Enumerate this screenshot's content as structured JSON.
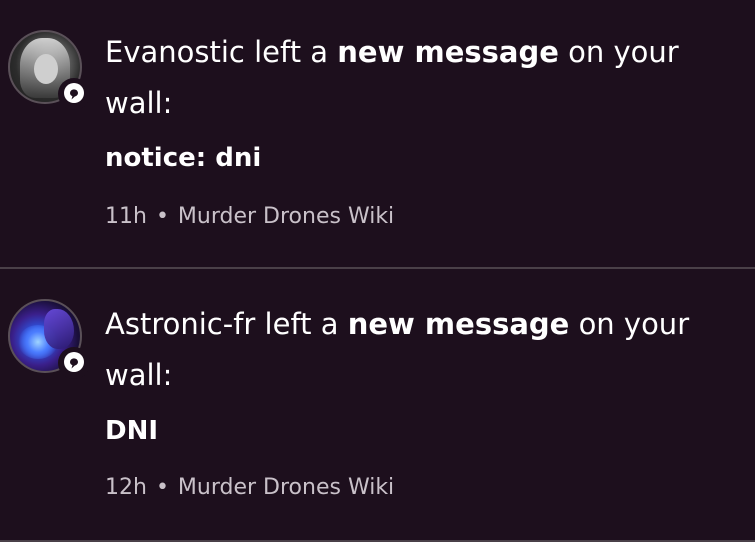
{
  "notifications": [
    {
      "actor": "Evanostic",
      "action_prefix": "left a",
      "action_bold": "new message",
      "action_suffix": "on your",
      "action_line2": "wall:",
      "message": "notice: dni",
      "time": "11h",
      "separator": "•",
      "wiki": "Murder Drones Wiki",
      "badge_icon": "speech-bubble-icon"
    },
    {
      "actor": "Astronic-fr",
      "action_prefix": "left a",
      "action_bold": "new message",
      "action_suffix": "on your",
      "action_line2": "wall:",
      "message": "DNI",
      "time": "12h",
      "separator": "•",
      "wiki": "Murder Drones Wiki",
      "badge_icon": "speech-bubble-icon"
    }
  ],
  "colors": {
    "background": "#1d0f1d",
    "text": "#ffffff",
    "meta_text": "#c9c1c9",
    "divider": "#4a4048"
  }
}
